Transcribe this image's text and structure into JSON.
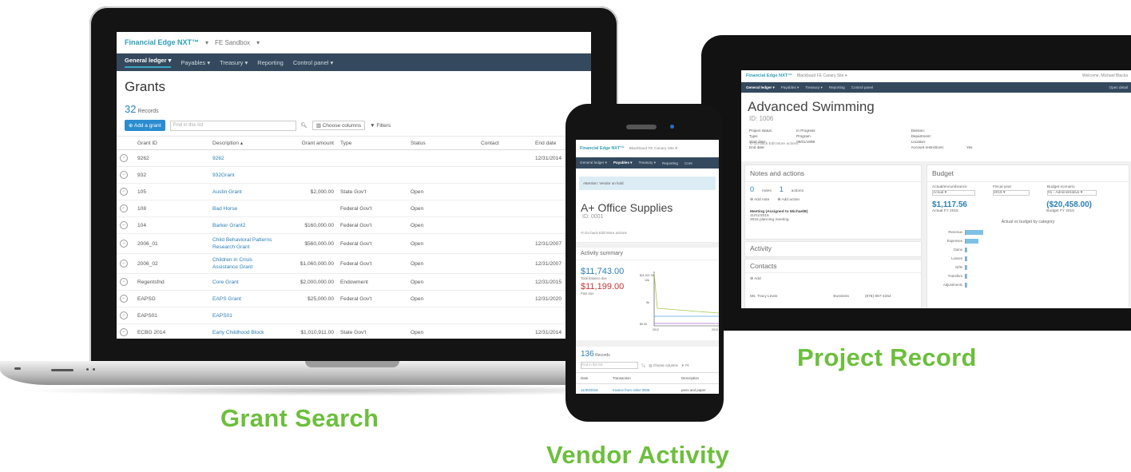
{
  "captions": {
    "laptop": "Grant Search",
    "phone": "Vendor Activity",
    "tablet": "Project Record"
  },
  "laptop": {
    "brand": "Financial Edge NXT™",
    "env": "FE Sandbox",
    "nav": [
      "General ledger",
      "Payables",
      "Treasury",
      "Reporting",
      "Control panel"
    ],
    "page_title": "Grants",
    "records_count": "32",
    "records_label": "Records",
    "add_button": "Add a grant",
    "search_placeholder": "Find in this list",
    "choose_columns": "Choose columns",
    "filters": "Filters",
    "columns": [
      "Grant ID",
      "Description",
      "Grant amount",
      "Type",
      "Status",
      "Contact",
      "End date"
    ],
    "rows": [
      {
        "id": "9262",
        "desc": "9262",
        "amount": "",
        "type": "",
        "status": "",
        "contact": "",
        "end": "12/31/2014"
      },
      {
        "id": "932",
        "desc": "932Grant",
        "amount": "",
        "type": "",
        "status": "",
        "contact": "",
        "end": ""
      },
      {
        "id": "105",
        "desc": "Austin Grant",
        "amount": "$2,000.00",
        "type": "State Gov't",
        "status": "Open",
        "contact": "",
        "end": ""
      },
      {
        "id": "108",
        "desc": "Bad Horse",
        "amount": "",
        "type": "Federal Gov't",
        "status": "Open",
        "contact": "",
        "end": ""
      },
      {
        "id": "104",
        "desc": "Barker Grant2",
        "amount": "$160,000.00",
        "type": "Federal Gov't",
        "status": "Open",
        "contact": "",
        "end": ""
      },
      {
        "id": "2006_01",
        "desc": "Child Behavioral Patterns Research Grant",
        "amount": "$560,000.00",
        "type": "Federal Gov't",
        "status": "Open",
        "contact": "",
        "end": "12/31/2007"
      },
      {
        "id": "2006_02",
        "desc": "Children in Crisis Assistance Grant",
        "amount": "$1,060,000.00",
        "type": "Federal Gov't",
        "status": "Open",
        "contact": "",
        "end": "12/31/2007"
      },
      {
        "id": "Regentsfnd",
        "desc": "Core Grant",
        "amount": "$2,000,000.00",
        "type": "Endowment",
        "status": "Open",
        "contact": "",
        "end": "12/31/2015"
      },
      {
        "id": "EAPSG",
        "desc": "EAPS Grant",
        "amount": "$25,000.00",
        "type": "Federal Gov't",
        "status": "Open",
        "contact": "",
        "end": "12/31/2020"
      },
      {
        "id": "EAPS01",
        "desc": "EAPS01",
        "amount": "",
        "type": "",
        "status": "",
        "contact": "",
        "end": ""
      },
      {
        "id": "ECBG 2014",
        "desc": "Early Childhood Block",
        "amount": "$1,010,911.00",
        "type": "State Gov't",
        "status": "Open",
        "contact": "",
        "end": "12/31/2014"
      }
    ]
  },
  "phone": {
    "brand": "Financial Edge NXT™",
    "env": "Blackbaud FE Canary Site",
    "nav": [
      "General ledger",
      "Payables",
      "Treasury",
      "Reporting",
      "Cont"
    ],
    "banner": "Attention: Vendor on hold",
    "vendor_name": "A+ Office Supplies",
    "vendor_id": "ID: 0001",
    "actions": "Go back   Edit   More actions",
    "summary_title": "Activity summary",
    "total_balance": "$11,743.00",
    "total_balance_label": "Total balance due",
    "past_due": "$11,199.00",
    "past_due_label": "Past due",
    "chart_top": "$11,537.00",
    "chart_tick_1": "10k",
    "chart_tick_2": "5k",
    "chart_tick_3": "$0.00",
    "chart_year_1": "2012",
    "chart_year_2": "2013",
    "records_count": "136",
    "records_label": "Records",
    "search_placeholder": "Find in this list",
    "choose_columns": "Choose columns",
    "filters": "Fil",
    "columns": [
      "Date",
      "Transaction",
      "Description"
    ],
    "row": [
      "11/30/2015",
      "Invoice from order 0006",
      "pens and paper"
    ]
  },
  "tablet": {
    "brand": "Financial Edge NXT™",
    "env": "Blackbaud FE Canary Site",
    "welcome": "Welcome, Michael Blacka",
    "nav": [
      "General ledger",
      "Payables",
      "Treasury",
      "Reporting",
      "Control panel"
    ],
    "open_details": "Open detail",
    "project_name": "Advanced Swimming",
    "project_id": "ID: 1006",
    "props_left_labels": [
      "Project status:",
      "Type:",
      "Start date:",
      "End date:"
    ],
    "props_left_values": [
      "In Progress",
      "Program",
      "09/01/1998",
      ""
    ],
    "props_right_labels": [
      "Division:",
      "Department:",
      "Location:",
      "Account restrictions:"
    ],
    "props_right_values": [
      "",
      "",
      "",
      "Yes"
    ],
    "actions": "Go back   Edit   More actions",
    "notes_title": "Notes and actions",
    "notes_count": "0",
    "notes_label": "notes",
    "actions_count": "1",
    "actions_label": "actions",
    "add_note": "Add note",
    "add_action": "Add action",
    "meeting": "Meeting (Assigned to MichaelB)",
    "meeting_date": "11/01/2015",
    "meeting_desc": "2016 planning meeting",
    "activity_title": "Activity",
    "contacts_title": "Contacts",
    "add_contact": "Add",
    "contact_name": "Ms. Tracy Lewis",
    "contact_type": "Business",
    "contact_phone": "(876) 897-4254",
    "budget_title": "Budget",
    "col_actual": "Actual/encumbrance",
    "col_fiscal": "Fiscal year",
    "col_scenario": "Budget scenario",
    "sel_actual": "Actual",
    "sel_fiscal": "2015",
    "sel_scenario": "01 - Administrative",
    "actual_value": "$1,117.56",
    "actual_label": "Actual FY 2015",
    "budget_value": "($20,458.00)",
    "budget_label": "Budget FY 2015",
    "chart_title": "Actual vs budget by category",
    "categories": [
      "Revenue",
      "Expenses",
      "Gains",
      "Losses",
      "Gifts",
      "Transfers",
      "Adjustments"
    ]
  }
}
